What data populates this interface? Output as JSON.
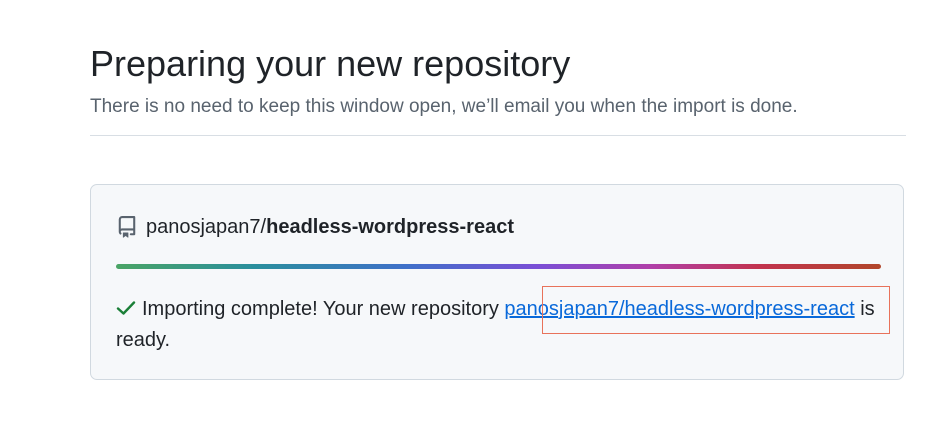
{
  "page": {
    "title": "Preparing your new repository",
    "subtitle": "There is no need to keep this window open, we’ll email you when the import is done."
  },
  "repo": {
    "owner": "panosjapan7/",
    "name": "headless-wordpress-react",
    "icon": "repo-icon"
  },
  "progress": {
    "percent": 100,
    "colors": [
      "#4aa465",
      "#3f70c9",
      "#7a4fd6",
      "#b03fa8",
      "#c2334e",
      "#b1462a"
    ]
  },
  "status": {
    "icon": "check-icon",
    "icon_color": "#1a7f37",
    "prefix": "Importing complete! Your new repository ",
    "link_text": "panosjapan7/headless-wordpress-react",
    "suffix": " is ready."
  },
  "colors": {
    "link": "#0969da",
    "highlight_border": "#e8725a"
  }
}
